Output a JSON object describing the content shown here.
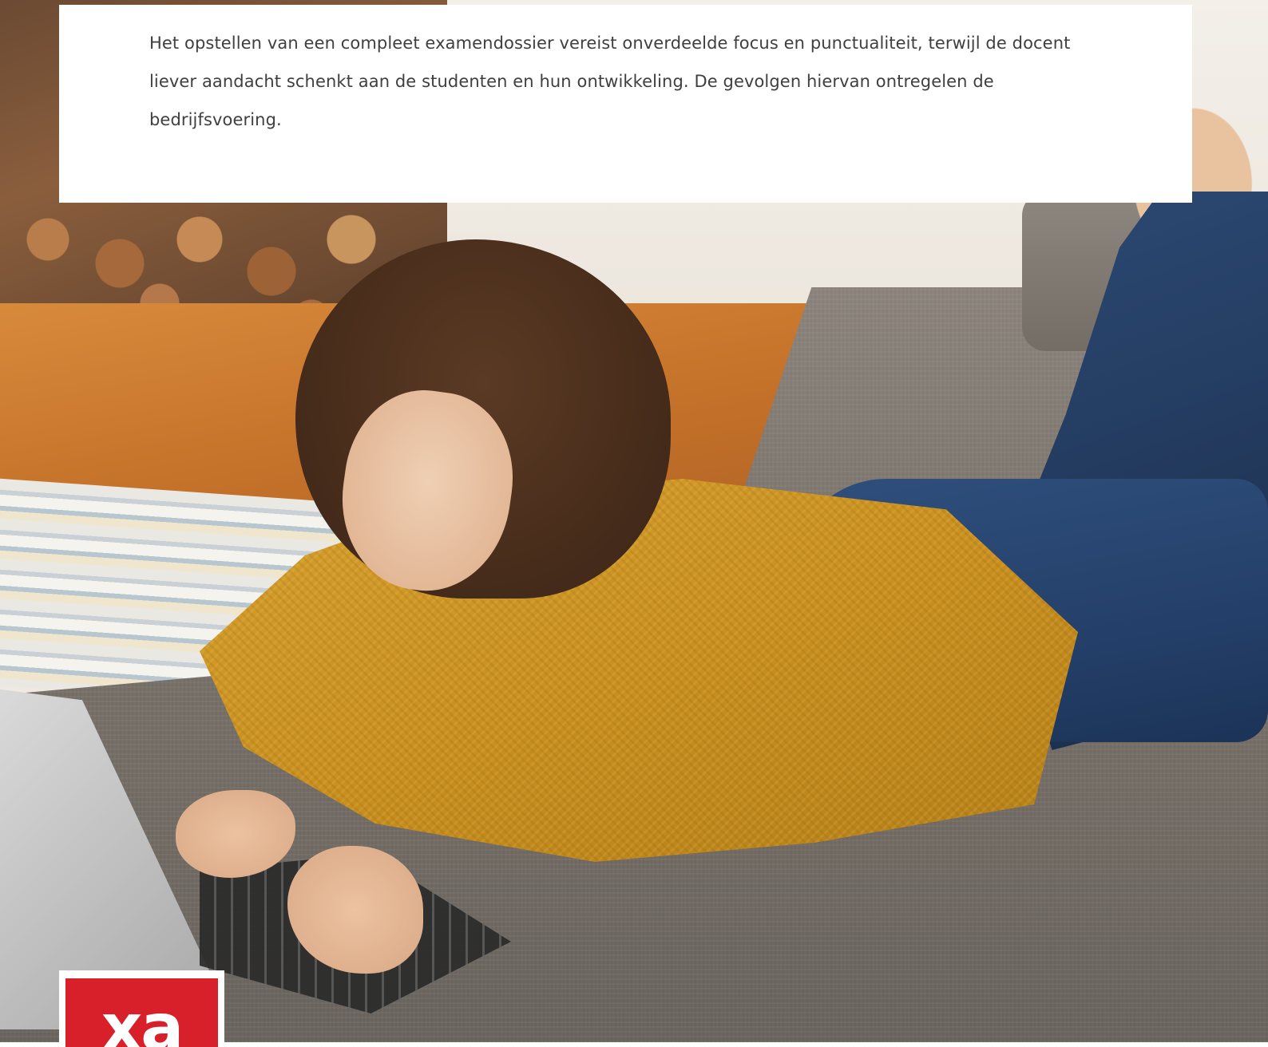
{
  "intro": {
    "paragraph": "Het opstellen van een compleet examendossier vereist onverdeelde focus en punctualiteit, terwijl de docent liever aandacht schenkt aan de studenten en hun ontwikkeling. De gevolgen hiervan ontregelen de bedrijfsvoering."
  },
  "logo": {
    "text": "xa",
    "brand_color": "#d8202a"
  },
  "colors": {
    "card_background": "#ffffff",
    "body_text": "#3f3f3f"
  }
}
